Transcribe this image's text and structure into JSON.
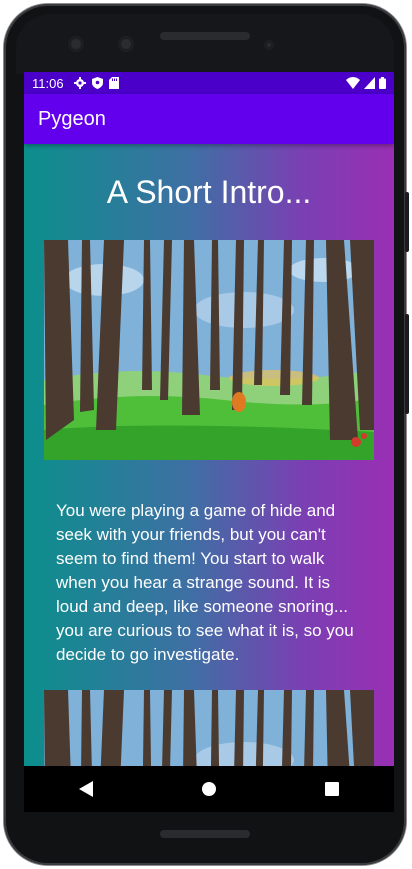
{
  "status_bar": {
    "time": "11:06",
    "left_icons": [
      "gear-icon",
      "shield-icon",
      "sd-card-icon"
    ],
    "right_icons": [
      "wifi-icon",
      "cell-signal-icon",
      "battery-icon"
    ]
  },
  "app_bar": {
    "title": "Pygeon"
  },
  "content": {
    "heading": "A Short Intro...",
    "images": [
      "forest-illustration",
      "forest-illustration"
    ],
    "story": "You were playing a game of hide and seek with your friends, but you can't seem to find them! You start to walk when you hear a strange sound. It is loud and deep, like someone snoring... you are curious to see what it is, so you decide to go investigate."
  },
  "nav_bar": {
    "buttons": [
      "back-icon",
      "home-icon",
      "recents-icon"
    ]
  },
  "colors": {
    "status_bar": "#4a00c8",
    "app_bar": "#6200ee",
    "gradient_start": "#0b8f8c",
    "gradient_end": "#9a2fb3"
  }
}
